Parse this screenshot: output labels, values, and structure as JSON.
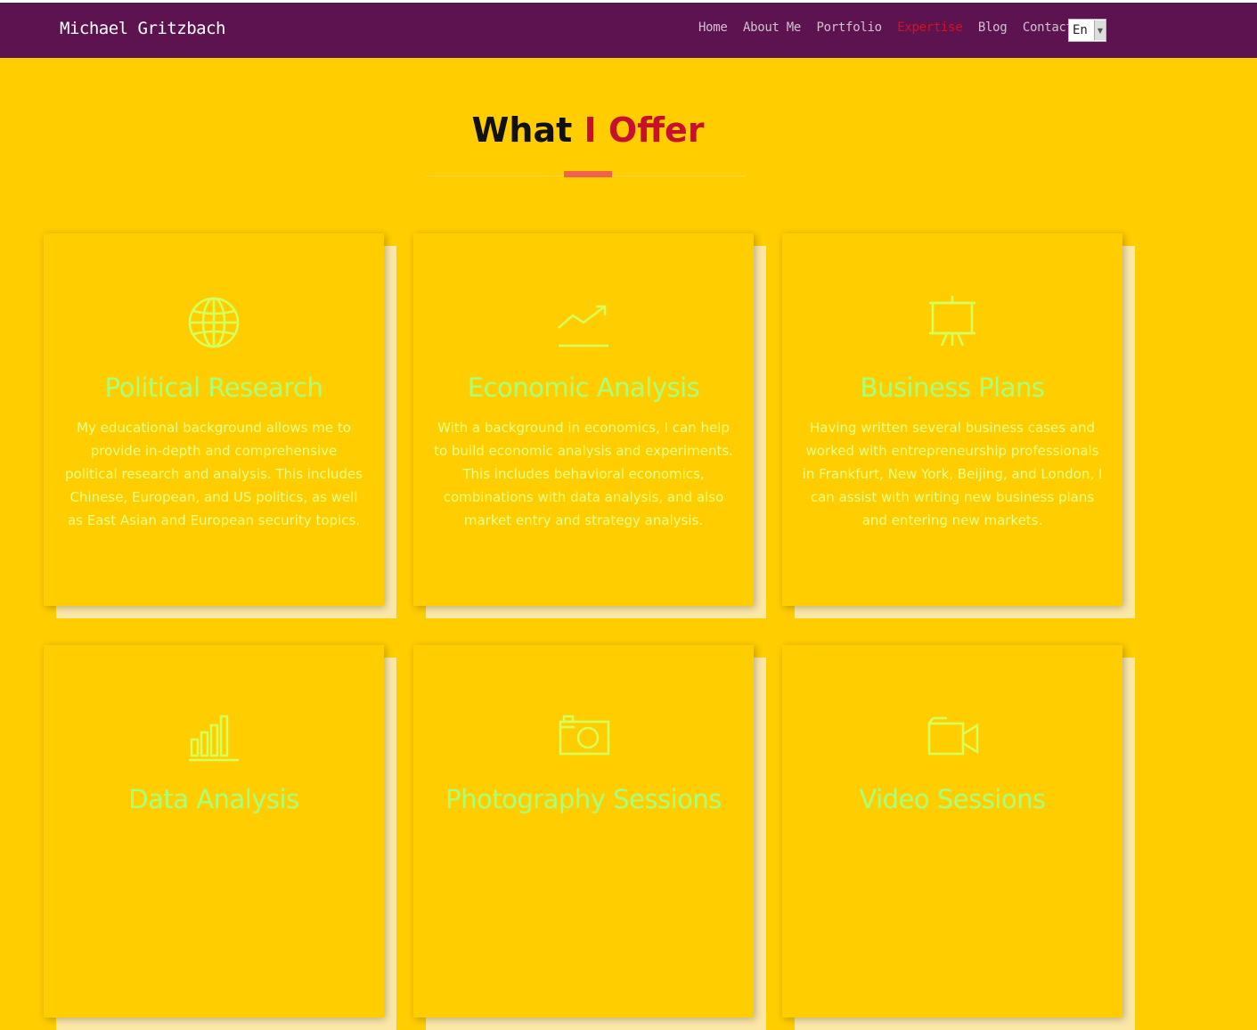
{
  "header": {
    "brand": "Michael Gritzbach",
    "nav": [
      "Home",
      "About Me",
      "Portfolio",
      "Expertise",
      "Blog",
      "Contact"
    ],
    "active_nav": "Expertise",
    "language": "En"
  },
  "section": {
    "title_part1": "What",
    "title_part2": "I Offer"
  },
  "cards": [
    {
      "icon": "globe-icon",
      "title": "Political Research",
      "description": "My educational background allows me to provide in-depth and comprehensive political research and analysis. This includes Chinese, European, and US politics, as well as East Asian and European security topics."
    },
    {
      "icon": "trend-chart-icon",
      "title": "Economic Analysis",
      "description": "With a background in economics, I can help to build economic analysis and experiments. This includes behavioral economics, combinations with data analysis, and also market entry and strategy analysis."
    },
    {
      "icon": "presentation-board-icon",
      "title": "Business Plans",
      "description": "Having written several business cases and worked with entrepreneurship professionals in Frankfurt, New York, Beijing, and London, I can assist with writing new business plans and entering new markets."
    },
    {
      "icon": "bar-chart-icon",
      "title": "Data Analysis",
      "description": ""
    },
    {
      "icon": "camera-icon",
      "title": "Photography Sessions",
      "description": ""
    },
    {
      "icon": "video-camera-icon",
      "title": "Video Sessions",
      "description": ""
    }
  ],
  "colors": {
    "background": "#ffcd00",
    "navbar": "#5e1351",
    "accent": "#c8102e",
    "divider": "#f0624d",
    "card_title": "#aaff7a",
    "card_text": "#e8ff87"
  }
}
